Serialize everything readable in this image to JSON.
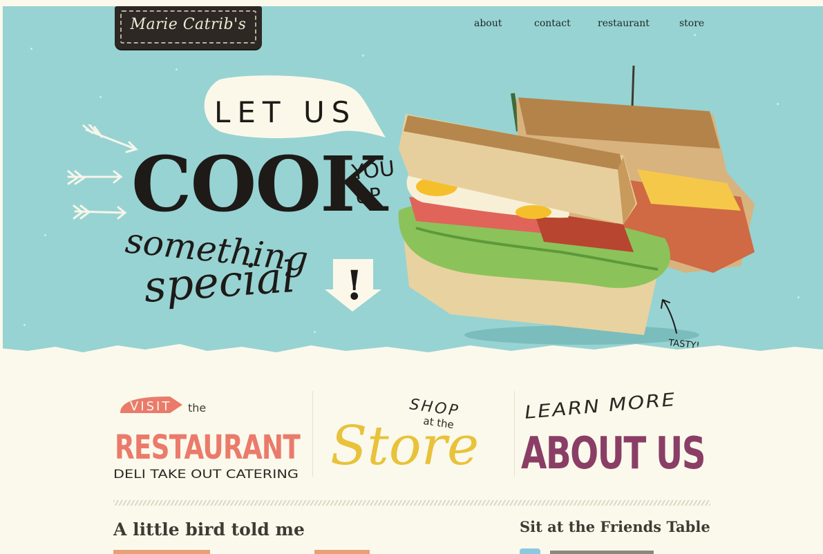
{
  "brand": {
    "logo_text": "Marie Catrib's"
  },
  "nav": {
    "items": [
      {
        "label": "about"
      },
      {
        "label": "contact"
      },
      {
        "label": "restaurant"
      },
      {
        "label": "store"
      }
    ]
  },
  "hero": {
    "bubble_text": "LET US",
    "line_cook": "COOK",
    "line_you_up_1": "YOU",
    "line_you_up_2": "UP",
    "line_something": "something",
    "line_special": "special",
    "exclaim": "!",
    "tasty": "TASTY!",
    "colors": {
      "sky": "#97d3d2",
      "ink": "#1d1a17",
      "cream": "#fbf9ec"
    }
  },
  "promos": {
    "restaurant": {
      "visit": "VISIT",
      "the": "the",
      "title": "RESTAURANT",
      "sub": "DELI TAKE OUT CATERING",
      "color": "#ea7b6b"
    },
    "store": {
      "shop": "SHOP",
      "atthe": "at the",
      "title": "Store",
      "color": "#e8c23a"
    },
    "about": {
      "learn": "LEARN MORE",
      "title": "ABOUT US",
      "color": "#8a3e66"
    }
  },
  "sections": {
    "left_heading": "A little bird told me",
    "right_heading": "Sit at the Friends Table"
  }
}
